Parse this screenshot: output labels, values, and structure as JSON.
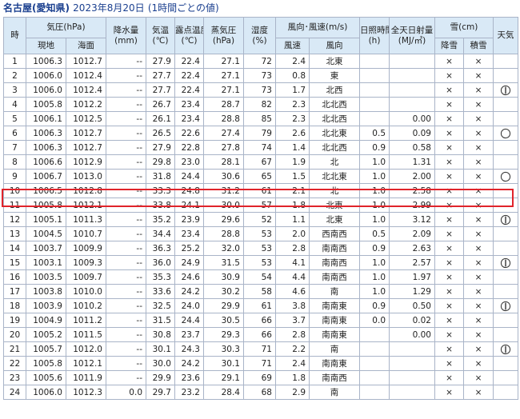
{
  "title": {
    "station": "名古屋(愛知県)",
    "date": "2023年8月20日",
    "note": "(1時間ごとの値)"
  },
  "headers": {
    "hour": "時",
    "pressure_group": "気圧(hPa)",
    "pressure_station": "現地",
    "pressure_sea": "海面",
    "precip": "降水量",
    "precip_unit": "(mm)",
    "temp": "気温",
    "temp_unit": "(℃)",
    "dew": "露点温度",
    "dew_unit": "(℃)",
    "vapor": "蒸気圧",
    "vapor_unit": "(hPa)",
    "humidity": "湿度",
    "humidity_unit": "(%)",
    "wind_group": "風向･風速(m/s)",
    "wind_speed": "風速",
    "wind_dir": "風向",
    "sunshine": "日照時間",
    "sunshine_unit": "(h)",
    "solar": "全天日射量",
    "solar_unit": "(MJ/㎡)",
    "snow_group": "雪(cm)",
    "snowfall": "降雪",
    "snow_depth": "積雪",
    "weather": "天気"
  },
  "icons": {
    "snow_none": "×",
    "weather_thunder": "thunder-icon",
    "weather_clear": "clear-circle-icon"
  },
  "colors": {
    "header_bg": "#d9e9f6",
    "highlight": "#e0242b",
    "title": "#1a3f8f"
  },
  "rows": [
    {
      "hour": "1",
      "p_st": "1006.3",
      "p_sea": "1012.7",
      "precip": "--",
      "temp": "27.9",
      "dew": "22.4",
      "vapor": "27.1",
      "hum": "72",
      "ws": "2.4",
      "wd": "北東",
      "sun": "",
      "solar": "",
      "snowfall": "×",
      "snowdepth": "×",
      "weather": ""
    },
    {
      "hour": "2",
      "p_st": "1006.0",
      "p_sea": "1012.4",
      "precip": "--",
      "temp": "27.7",
      "dew": "22.4",
      "vapor": "27.1",
      "hum": "73",
      "ws": "0.8",
      "wd": "東",
      "sun": "",
      "solar": "",
      "snowfall": "×",
      "snowdepth": "×",
      "weather": ""
    },
    {
      "hour": "3",
      "p_st": "1006.0",
      "p_sea": "1012.4",
      "precip": "--",
      "temp": "27.7",
      "dew": "22.4",
      "vapor": "27.1",
      "hum": "73",
      "ws": "1.7",
      "wd": "北西",
      "sun": "",
      "solar": "",
      "snowfall": "×",
      "snowdepth": "×",
      "weather": "thunder"
    },
    {
      "hour": "4",
      "p_st": "1005.8",
      "p_sea": "1012.2",
      "precip": "--",
      "temp": "26.7",
      "dew": "23.4",
      "vapor": "28.7",
      "hum": "82",
      "ws": "2.3",
      "wd": "北北西",
      "sun": "",
      "solar": "",
      "snowfall": "×",
      "snowdepth": "×",
      "weather": ""
    },
    {
      "hour": "5",
      "p_st": "1006.1",
      "p_sea": "1012.5",
      "precip": "--",
      "temp": "26.1",
      "dew": "23.4",
      "vapor": "28.8",
      "hum": "85",
      "ws": "2.3",
      "wd": "北北西",
      "sun": "",
      "solar": "0.00",
      "snowfall": "×",
      "snowdepth": "×",
      "weather": ""
    },
    {
      "hour": "6",
      "p_st": "1006.3",
      "p_sea": "1012.7",
      "precip": "--",
      "temp": "26.5",
      "dew": "22.6",
      "vapor": "27.4",
      "hum": "79",
      "ws": "2.6",
      "wd": "北北東",
      "sun": "0.5",
      "solar": "0.09",
      "snowfall": "×",
      "snowdepth": "×",
      "weather": "clear"
    },
    {
      "hour": "7",
      "p_st": "1006.3",
      "p_sea": "1012.7",
      "precip": "--",
      "temp": "27.9",
      "dew": "22.8",
      "vapor": "27.8",
      "hum": "74",
      "ws": "1.4",
      "wd": "北北西",
      "sun": "0.9",
      "solar": "0.58",
      "snowfall": "×",
      "snowdepth": "×",
      "weather": ""
    },
    {
      "hour": "8",
      "p_st": "1006.6",
      "p_sea": "1012.9",
      "precip": "--",
      "temp": "29.8",
      "dew": "23.0",
      "vapor": "28.1",
      "hum": "67",
      "ws": "1.9",
      "wd": "北",
      "sun": "1.0",
      "solar": "1.31",
      "snowfall": "×",
      "snowdepth": "×",
      "weather": ""
    },
    {
      "hour": "9",
      "p_st": "1006.7",
      "p_sea": "1013.0",
      "precip": "--",
      "temp": "31.8",
      "dew": "24.4",
      "vapor": "30.6",
      "hum": "65",
      "ws": "1.5",
      "wd": "北北東",
      "sun": "1.0",
      "solar": "2.00",
      "snowfall": "×",
      "snowdepth": "×",
      "weather": "clear"
    },
    {
      "hour": "10",
      "p_st": "1006.5",
      "p_sea": "1012.8",
      "precip": "--",
      "temp": "33.3",
      "dew": "24.8",
      "vapor": "31.2",
      "hum": "61",
      "ws": "2.1",
      "wd": "北",
      "sun": "1.0",
      "solar": "2.58",
      "snowfall": "×",
      "snowdepth": "×",
      "weather": ""
    },
    {
      "hour": "11",
      "p_st": "1005.8",
      "p_sea": "1012.1",
      "precip": "--",
      "temp": "33.8",
      "dew": "24.1",
      "vapor": "30.0",
      "hum": "57",
      "ws": "1.8",
      "wd": "北東",
      "sun": "1.0",
      "solar": "2.99",
      "snowfall": "×",
      "snowdepth": "×",
      "weather": ""
    },
    {
      "hour": "12",
      "p_st": "1005.1",
      "p_sea": "1011.3",
      "precip": "--",
      "temp": "35.2",
      "dew": "23.9",
      "vapor": "29.6",
      "hum": "52",
      "ws": "1.1",
      "wd": "北東",
      "sun": "1.0",
      "solar": "3.12",
      "snowfall": "×",
      "snowdepth": "×",
      "weather": "thunder"
    },
    {
      "hour": "13",
      "p_st": "1004.5",
      "p_sea": "1010.7",
      "precip": "--",
      "temp": "34.4",
      "dew": "23.4",
      "vapor": "28.8",
      "hum": "53",
      "ws": "2.0",
      "wd": "西南西",
      "sun": "0.5",
      "solar": "2.09",
      "snowfall": "×",
      "snowdepth": "×",
      "weather": ""
    },
    {
      "hour": "14",
      "p_st": "1003.7",
      "p_sea": "1009.9",
      "precip": "--",
      "temp": "36.3",
      "dew": "25.2",
      "vapor": "32.0",
      "hum": "53",
      "ws": "2.8",
      "wd": "南南西",
      "sun": "0.9",
      "solar": "2.63",
      "snowfall": "×",
      "snowdepth": "×",
      "weather": ""
    },
    {
      "hour": "15",
      "p_st": "1003.1",
      "p_sea": "1009.3",
      "precip": "--",
      "temp": "36.0",
      "dew": "24.9",
      "vapor": "31.5",
      "hum": "53",
      "ws": "4.1",
      "wd": "南南西",
      "sun": "1.0",
      "solar": "2.57",
      "snowfall": "×",
      "snowdepth": "×",
      "weather": "thunder"
    },
    {
      "hour": "16",
      "p_st": "1003.5",
      "p_sea": "1009.7",
      "precip": "--",
      "temp": "35.3",
      "dew": "24.6",
      "vapor": "30.9",
      "hum": "54",
      "ws": "4.4",
      "wd": "南南西",
      "sun": "1.0",
      "solar": "1.97",
      "snowfall": "×",
      "snowdepth": "×",
      "weather": ""
    },
    {
      "hour": "17",
      "p_st": "1003.8",
      "p_sea": "1010.0",
      "precip": "--",
      "temp": "33.6",
      "dew": "24.2",
      "vapor": "30.2",
      "hum": "58",
      "ws": "4.6",
      "wd": "南",
      "sun": "1.0",
      "solar": "1.29",
      "snowfall": "×",
      "snowdepth": "×",
      "weather": ""
    },
    {
      "hour": "18",
      "p_st": "1003.9",
      "p_sea": "1010.2",
      "precip": "--",
      "temp": "32.5",
      "dew": "24.0",
      "vapor": "29.9",
      "hum": "61",
      "ws": "3.8",
      "wd": "南南東",
      "sun": "0.9",
      "solar": "0.50",
      "snowfall": "×",
      "snowdepth": "×",
      "weather": "thunder"
    },
    {
      "hour": "19",
      "p_st": "1004.9",
      "p_sea": "1011.2",
      "precip": "--",
      "temp": "31.5",
      "dew": "24.4",
      "vapor": "30.5",
      "hum": "66",
      "ws": "3.7",
      "wd": "南南東",
      "sun": "0.0",
      "solar": "0.02",
      "snowfall": "×",
      "snowdepth": "×",
      "weather": ""
    },
    {
      "hour": "20",
      "p_st": "1005.2",
      "p_sea": "1011.5",
      "precip": "--",
      "temp": "30.8",
      "dew": "23.7",
      "vapor": "29.3",
      "hum": "66",
      "ws": "2.8",
      "wd": "南南東",
      "sun": "",
      "solar": "0.00",
      "snowfall": "×",
      "snowdepth": "×",
      "weather": ""
    },
    {
      "hour": "21",
      "p_st": "1005.7",
      "p_sea": "1012.0",
      "precip": "--",
      "temp": "30.1",
      "dew": "24.3",
      "vapor": "30.3",
      "hum": "71",
      "ws": "2.2",
      "wd": "南",
      "sun": "",
      "solar": "",
      "snowfall": "×",
      "snowdepth": "×",
      "weather": "thunder"
    },
    {
      "hour": "22",
      "p_st": "1005.8",
      "p_sea": "1012.1",
      "precip": "--",
      "temp": "30.0",
      "dew": "24.2",
      "vapor": "30.1",
      "hum": "71",
      "ws": "2.4",
      "wd": "南南東",
      "sun": "",
      "solar": "",
      "snowfall": "×",
      "snowdepth": "×",
      "weather": ""
    },
    {
      "hour": "23",
      "p_st": "1005.6",
      "p_sea": "1011.9",
      "precip": "--",
      "temp": "29.9",
      "dew": "23.6",
      "vapor": "29.1",
      "hum": "69",
      "ws": "1.8",
      "wd": "南南西",
      "sun": "",
      "solar": "",
      "snowfall": "×",
      "snowdepth": "×",
      "weather": ""
    },
    {
      "hour": "24",
      "p_st": "1006.0",
      "p_sea": "1012.3",
      "precip": "0.0",
      "temp": "29.7",
      "dew": "23.2",
      "vapor": "28.4",
      "hum": "68",
      "ws": "2.9",
      "wd": "南",
      "sun": "",
      "solar": "",
      "snowfall": "×",
      "snowdepth": "×",
      "weather": ""
    }
  ]
}
